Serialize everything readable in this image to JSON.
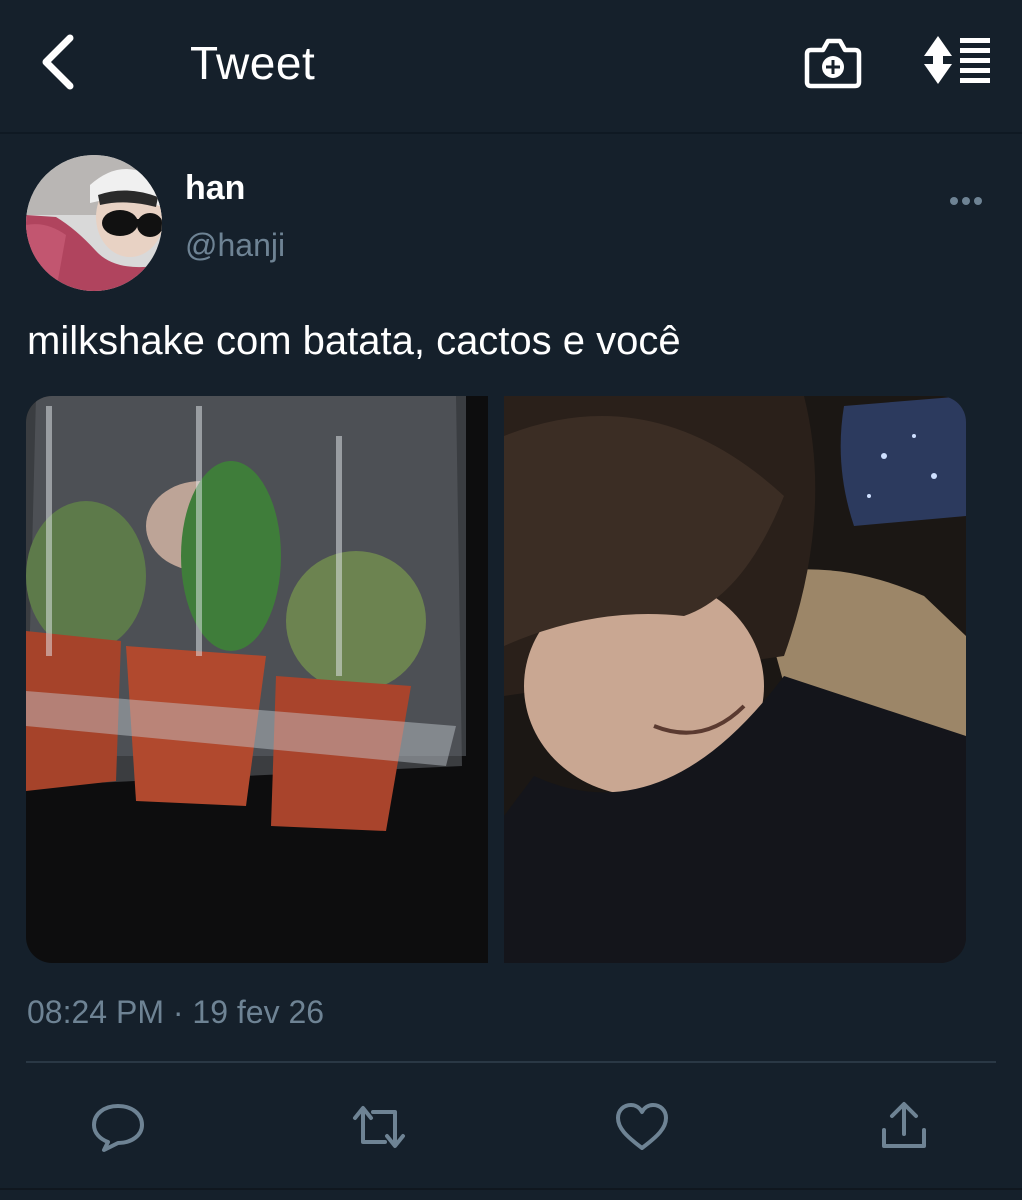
{
  "header": {
    "title": "Tweet",
    "back_icon": "chevron-left-icon",
    "camera_icon": "add-photo-icon",
    "sort_icon": "sort-toggle-icon"
  },
  "tweet": {
    "display_name": "han",
    "handle": "@hanji",
    "text": "milkshake com batata, cactos e você",
    "timestamp": "08:24 PM · 19 fev 26",
    "media_count": 2
  },
  "actions": {
    "reply_icon": "reply-icon",
    "retweet_icon": "retweet-icon",
    "like_icon": "heart-icon",
    "share_icon": "share-icon"
  },
  "colors": {
    "background": "#15202b",
    "text_primary": "#ffffff",
    "text_secondary": "#6e8394",
    "divider": "#2a3845"
  }
}
